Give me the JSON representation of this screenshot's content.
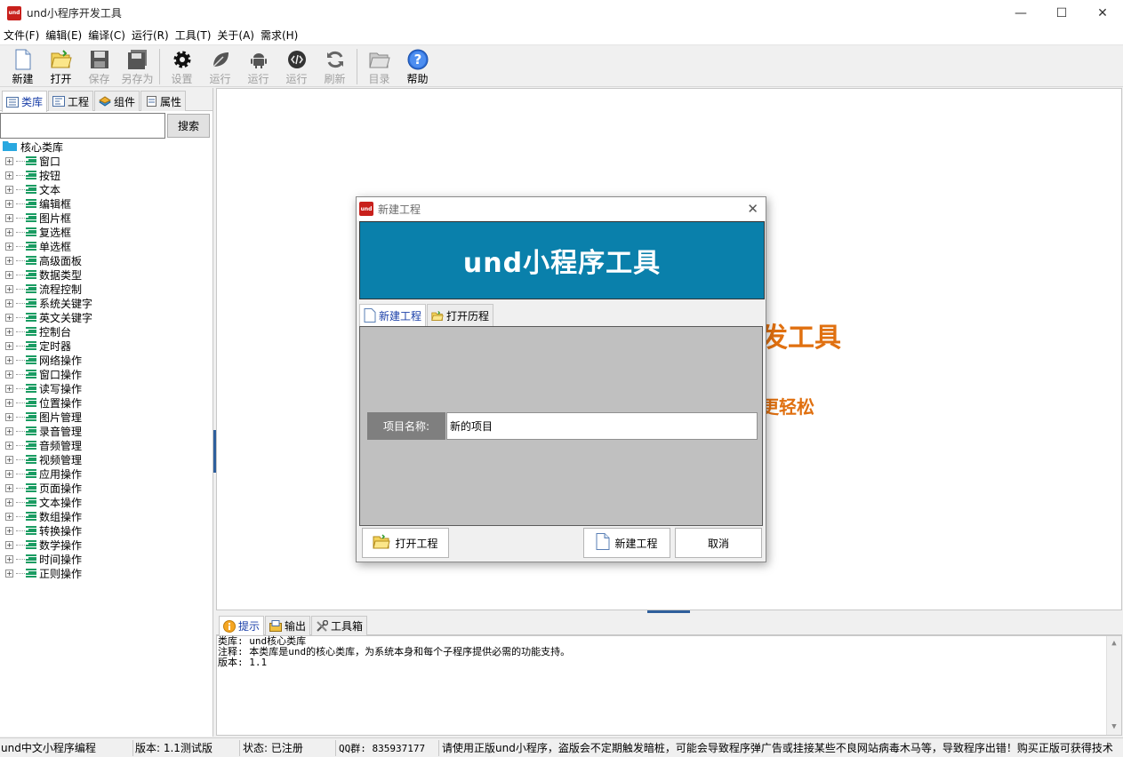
{
  "window": {
    "title": "und小程序开发工具",
    "logo_text": "und",
    "controls": {
      "minimize": "—",
      "maximize": "☐",
      "close": "✕"
    }
  },
  "menu": [
    "文件(F)",
    "编辑(E)",
    "编译(C)",
    "运行(R)",
    "工具(T)",
    "关于(A)",
    "需求(H)"
  ],
  "toolbar": {
    "new": "新建",
    "open": "打开",
    "save": "保存",
    "save_as": "另存为",
    "settings": "设置",
    "run1": "运行",
    "run2": "运行",
    "run3": "运行",
    "refresh": "刷新",
    "catalog": "目录",
    "help": "帮助"
  },
  "left_tabs": [
    "类库",
    "工程",
    "组件",
    "属性"
  ],
  "search": {
    "button": "搜索",
    "value": ""
  },
  "tree": {
    "root": "核心类库",
    "items": [
      "窗口",
      "按钮",
      "文本",
      "编辑框",
      "图片框",
      "复选框",
      "单选框",
      "高级面板",
      "数据类型",
      "流程控制",
      "系统关键字",
      "英文关键字",
      "控制台",
      "定时器",
      "网络操作",
      "窗口操作",
      "读写操作",
      "位置操作",
      "图片管理",
      "录音管理",
      "音频管理",
      "视频管理",
      "应用操作",
      "页面操作",
      "文本操作",
      "数组操作",
      "转换操作",
      "数学操作",
      "时间操作",
      "正则操作"
    ]
  },
  "background": {
    "text1": "发工具",
    "text2": "更轻松"
  },
  "bottom_tabs": [
    "提示",
    "输出",
    "工具箱"
  ],
  "output_lines": [
    "类库: und核心类库",
    "注释: 本类库是und的核心类库，为系统本身和每个子程序提供必需的功能支持。",
    "版本: 1.1"
  ],
  "statusbar": {
    "app": "und中文小程序编程",
    "version": "版本: 1.1测试版",
    "state": "状态: 已注册",
    "qq": "QQ群: 835937177",
    "notice": "请使用正版und小程序，盗版会不定期触发暗桩，可能会导致程序弹广告或挂接某些不良网站病毒木马等，导致程序出错！购买正版可获得技术"
  },
  "dialog": {
    "title": "新建工程",
    "banner": "und小程序工具",
    "tabs": [
      "新建工程",
      "打开历程"
    ],
    "field_label": "项目名称:",
    "field_value": "新的项目",
    "btn_open": "打开工程",
    "btn_new": "新建工程",
    "btn_cancel": "取消",
    "close": "✕"
  },
  "colors": {
    "accent_orange": "#e07010",
    "banner_blue": "#0a80ab",
    "tree_icon": "#1a9c62"
  }
}
